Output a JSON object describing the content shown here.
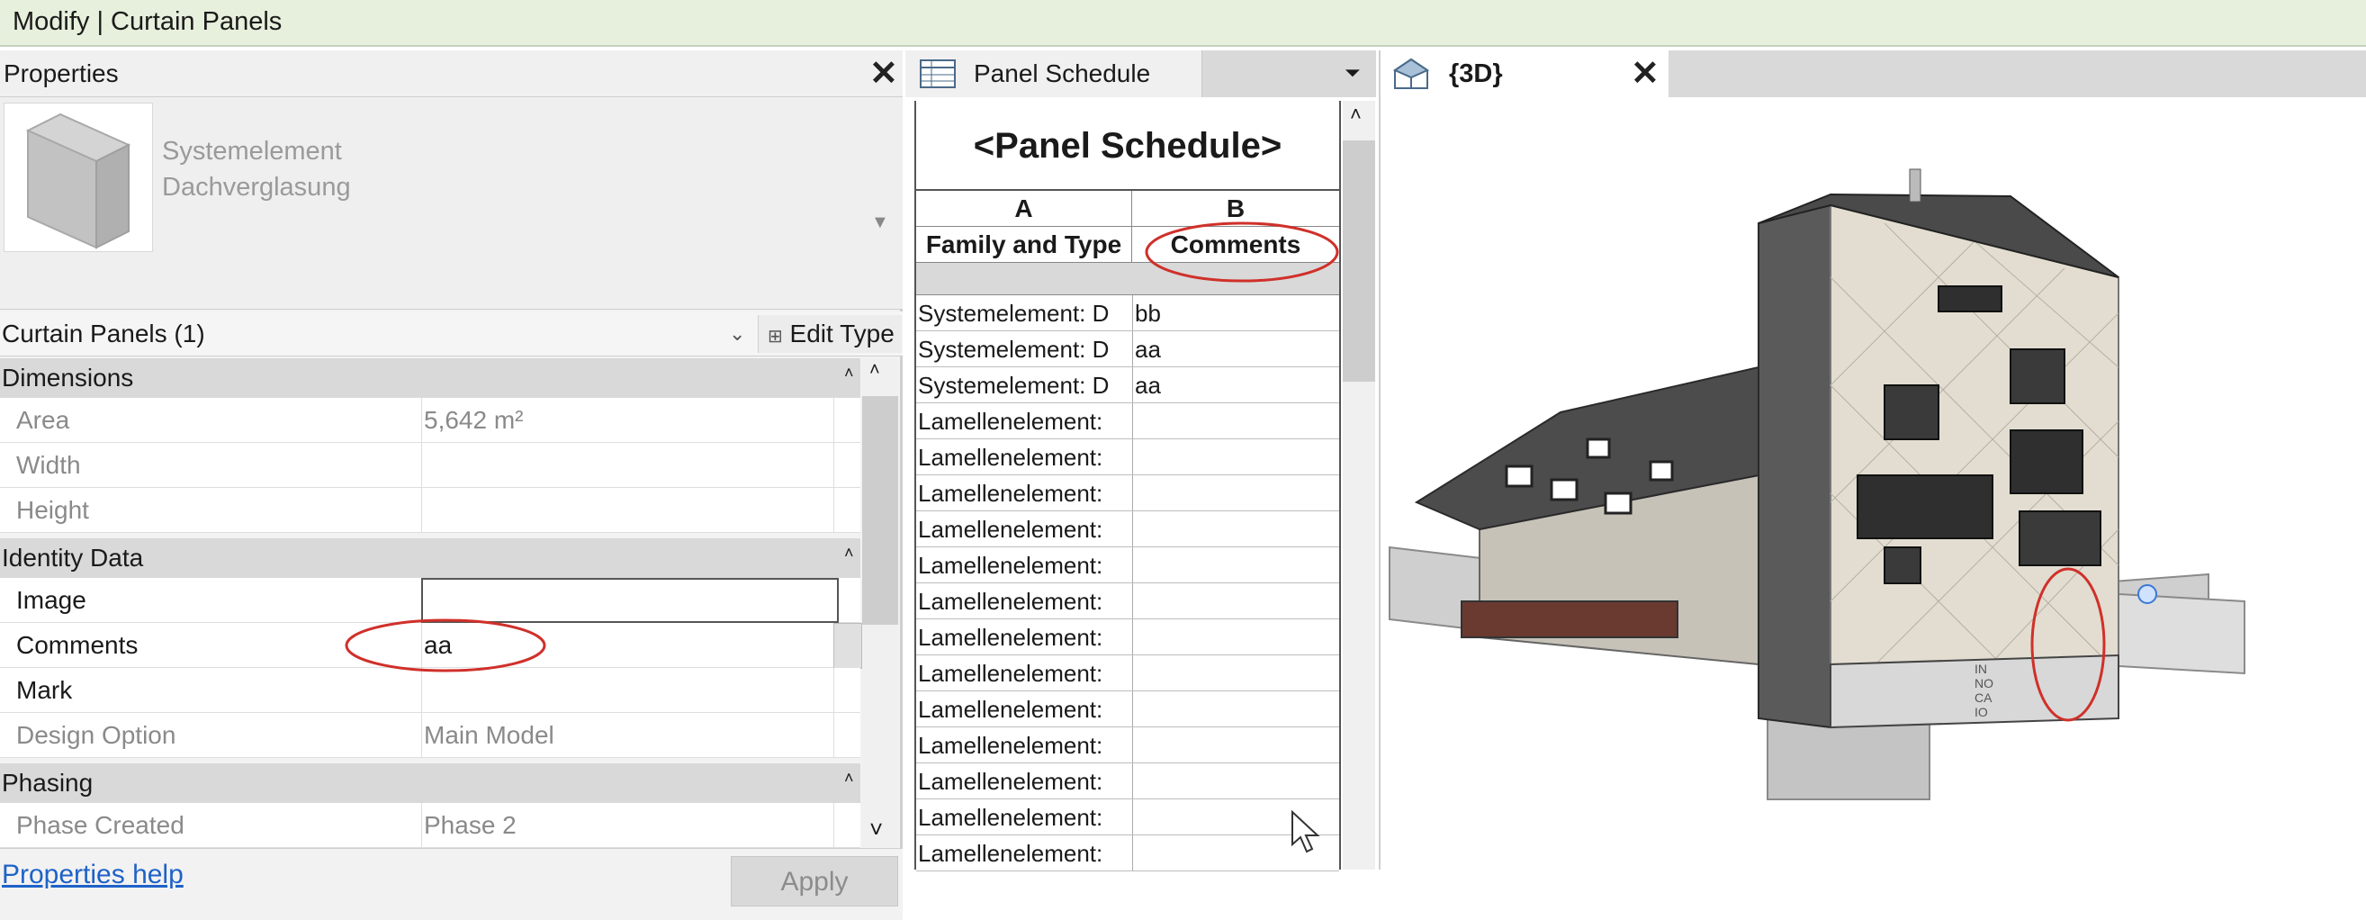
{
  "window": {
    "title": "Modify | Curtain Panels"
  },
  "properties": {
    "header": "Properties",
    "type_line1": "Systemelement",
    "type_line2": "Dachverglasung",
    "instance_selector": "Curtain Panels (1)",
    "edit_type": "Edit Type",
    "groups": {
      "dimensions": "Dimensions",
      "identity": "Identity Data",
      "phasing": "Phasing"
    },
    "rows": {
      "area": {
        "label": "Area",
        "value": "5,642 m²"
      },
      "width": {
        "label": "Width",
        "value": ""
      },
      "height": {
        "label": "Height",
        "value": ""
      },
      "image": {
        "label": "Image",
        "value": ""
      },
      "comments": {
        "label": "Comments",
        "value": "aa"
      },
      "mark": {
        "label": "Mark",
        "value": ""
      },
      "design_option": {
        "label": "Design Option",
        "value": "Main Model"
      },
      "phase_created": {
        "label": "Phase Created",
        "value": "Phase 2"
      }
    },
    "help_link": "Properties help",
    "apply": "Apply"
  },
  "schedule": {
    "tab_label": "Panel Schedule",
    "title": "<Panel Schedule>",
    "col_a_letter": "A",
    "col_b_letter": "B",
    "col_a_header": "Family and Type",
    "col_b_header": "Comments",
    "rows": [
      {
        "a": "Systemelement: D",
        "b": "bb"
      },
      {
        "a": "Systemelement: D",
        "b": "aa"
      },
      {
        "a": "Systemelement: D",
        "b": "aa"
      },
      {
        "a": "Lamellenelement:",
        "b": ""
      },
      {
        "a": "Lamellenelement:",
        "b": ""
      },
      {
        "a": "Lamellenelement:",
        "b": ""
      },
      {
        "a": "Lamellenelement:",
        "b": ""
      },
      {
        "a": "Lamellenelement:",
        "b": ""
      },
      {
        "a": "Lamellenelement:",
        "b": ""
      },
      {
        "a": "Lamellenelement:",
        "b": ""
      },
      {
        "a": "Lamellenelement:",
        "b": ""
      },
      {
        "a": "Lamellenelement:",
        "b": ""
      },
      {
        "a": "Lamellenelement:",
        "b": ""
      },
      {
        "a": "Lamellenelement:",
        "b": ""
      },
      {
        "a": "Lamellenelement:",
        "b": ""
      },
      {
        "a": "Lamellenelement:",
        "b": ""
      }
    ]
  },
  "view3d": {
    "tab_label": "{3D}",
    "facade_lettering": [
      "IN",
      "NO",
      "CA",
      "IO"
    ]
  },
  "annotation_color": "#d0302a",
  "icons": [
    "close-icon",
    "dropdown-arrow-icon",
    "edit-type-icon",
    "schedule-icon",
    "house-3d-icon",
    "cursor-icon",
    "scroll-up-icon",
    "scroll-down-icon",
    "collapse-icon"
  ]
}
